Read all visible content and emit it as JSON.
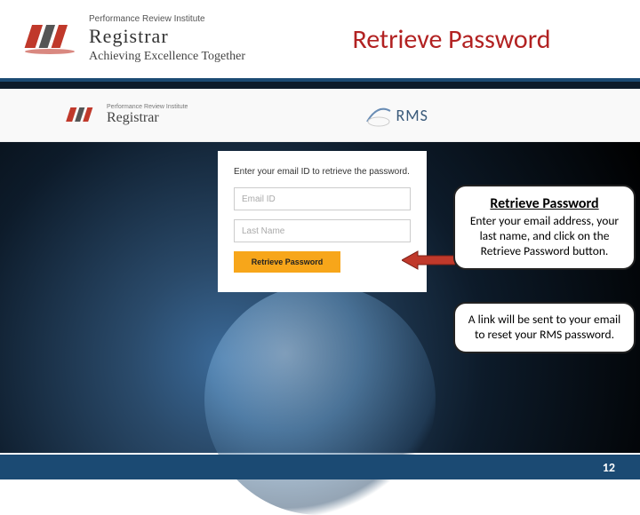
{
  "header": {
    "pri_line1": "Performance Review Institute",
    "registrar": "Registrar",
    "tagline": "Achieving Excellence Together",
    "title": "Retrieve Password"
  },
  "screenshot_header": {
    "pri_small": "Performance Review Institute",
    "registrar": "Registrar",
    "rms": "RMS"
  },
  "form": {
    "prompt": "Enter your email ID to retrieve the password.",
    "email_placeholder": "Email ID",
    "lastname_placeholder": "Last Name",
    "button_label": "Retrieve Password"
  },
  "callouts": {
    "c1_title": "Retrieve Password",
    "c1_body": "Enter your email address, your last name, and click on the Retrieve Password button.",
    "c2_body": "A link will be sent to your email to reset your RMS password."
  },
  "footer": {
    "page_number": "12"
  }
}
